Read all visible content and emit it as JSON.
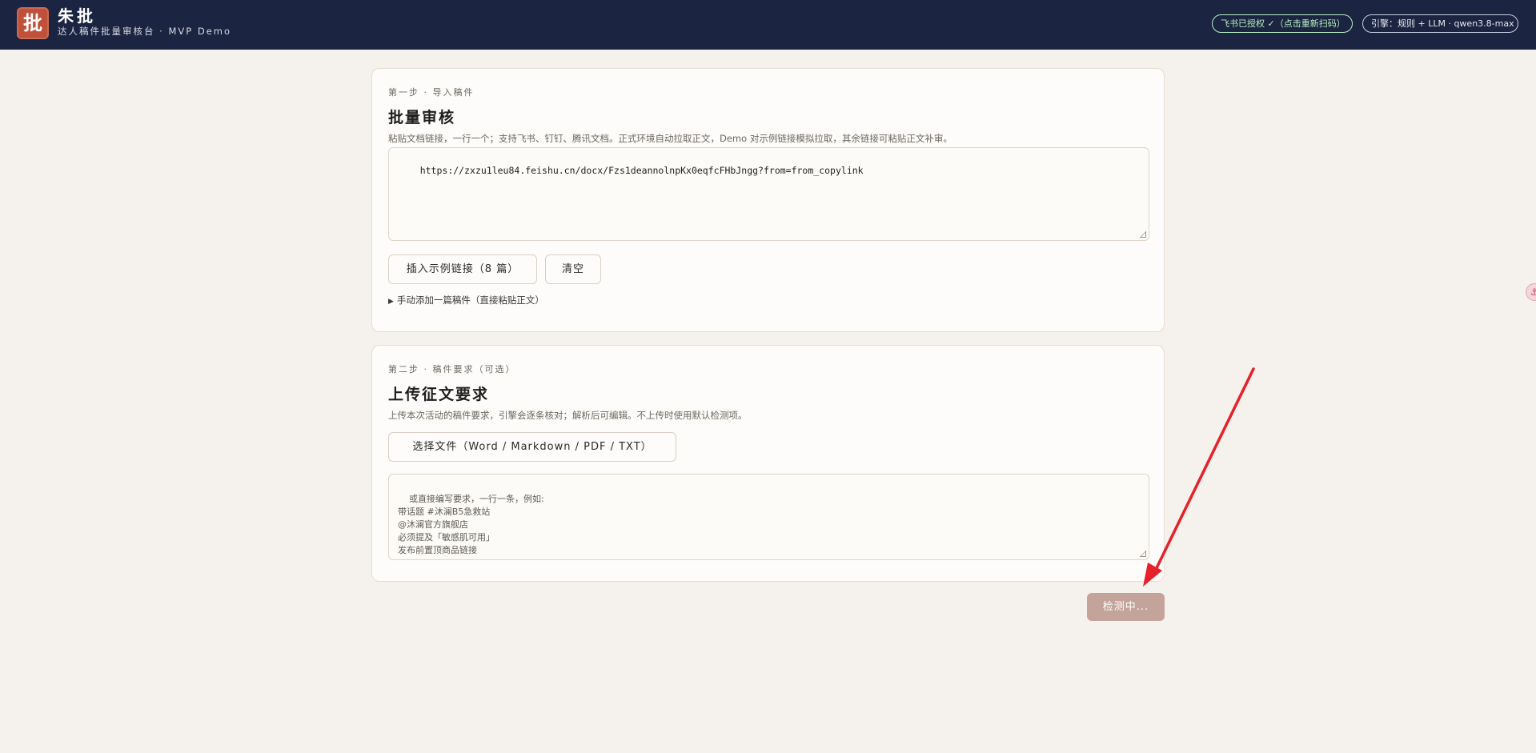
{
  "header": {
    "logo_char": "批",
    "title": "朱批",
    "subtitle": "达人稿件批量审核台 · MVP Demo",
    "auth_status": "飞书已授权 ✓（点击重新扫码）",
    "engine": "引擎：规则 + LLM · qwen3.8-max"
  },
  "step1": {
    "step_label": "第一步 · 导入稿件",
    "title": "批量审核",
    "description": "粘贴文档链接，一行一个；支持飞书、钉钉、腾讯文档。正式环境自动拉取正文，Demo 对示例链接模拟拉取，其余链接可粘贴正文补审。",
    "links_value": "https://zxzu1leu84.feishu.cn/docx/Fzs1deannolnpKx0eqfcFHbJngg?from=from_copylink",
    "insert_example_label": "插入示例链接（8 篇）",
    "clear_label": "清空",
    "manual_add_label": "手动添加一篇稿件（直接粘贴正文）"
  },
  "step2": {
    "step_label": "第二步 · 稿件要求（可选）",
    "title": "上传征文要求",
    "description": "上传本次活动的稿件要求，引擎会逐条核对；解析后可编辑。不上传时使用默认检测项。",
    "choose_file_label": "选择文件（Word / Markdown / PDF / TXT）",
    "requirements_placeholder": "或直接编写要求，一行一条，例如:\n带话题 #沐澜B5急救站\n@沐澜官方旗舰店\n必须提及「敏感肌可用」\n发布前置顶商品链接"
  },
  "actions": {
    "check_label": "检测中..."
  },
  "colors": {
    "header_bg": "#1b2440",
    "logo_bg": "#c0503a",
    "page_bg": "#f5f2ee",
    "check_button_bg": "#c4a49a",
    "auth_text": "#b8f0c4",
    "annotation_arrow": "#e8202a"
  }
}
